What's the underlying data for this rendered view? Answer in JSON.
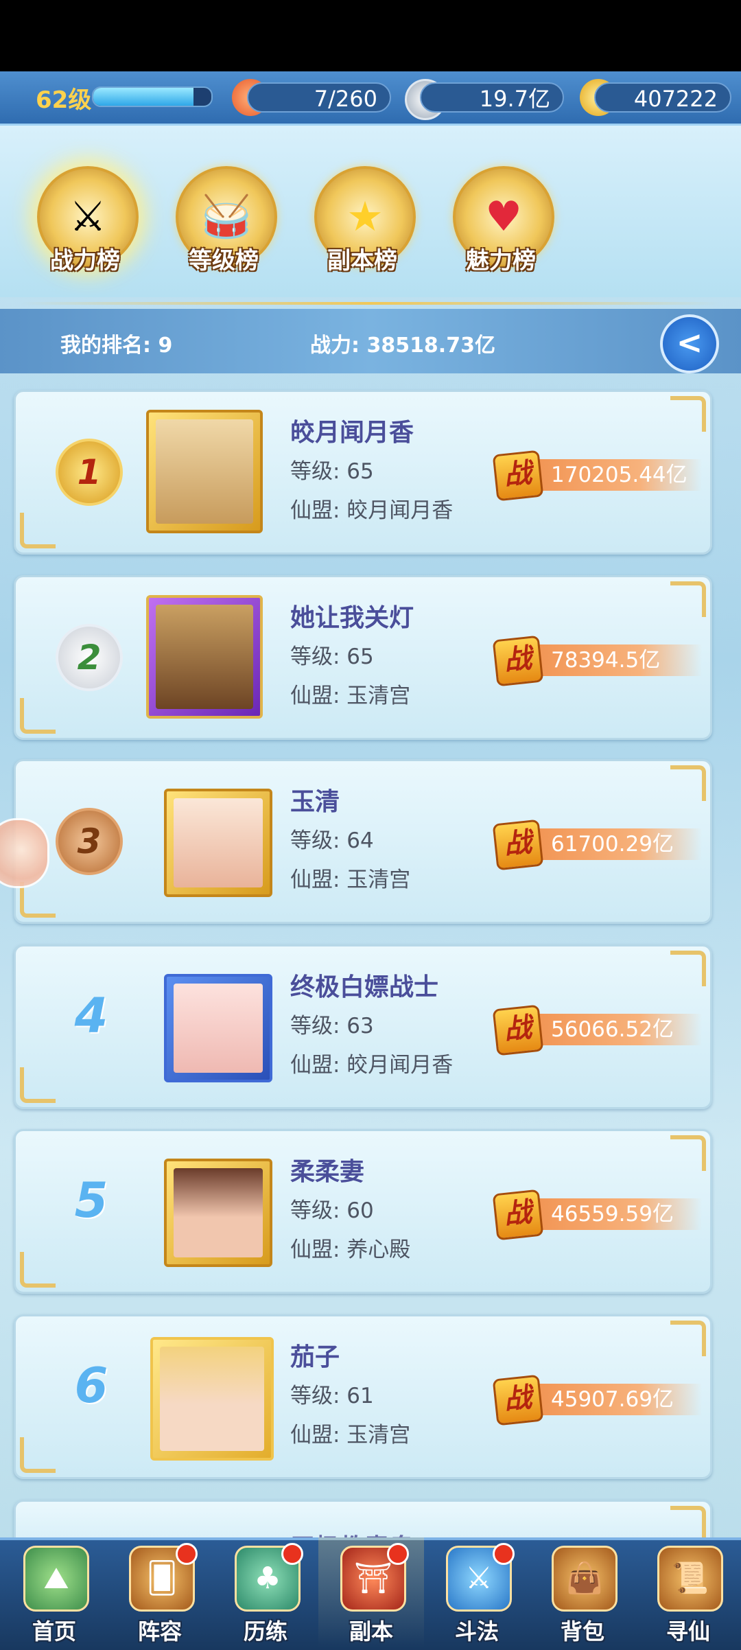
{
  "resources": {
    "level": "62级",
    "xp_fraction": 0.85,
    "stamina": "7/260",
    "silver": "19.7亿",
    "gold": "407222"
  },
  "tabs": [
    {
      "label": "战力榜",
      "icon": "sword-emblem-icon",
      "active": true
    },
    {
      "label": "等级榜",
      "icon": "drum-emblem-icon",
      "active": false
    },
    {
      "label": "副本榜",
      "icon": "star-emblem-icon",
      "active": false
    },
    {
      "label": "魅力榜",
      "icon": "heart-emblem-icon",
      "active": false
    }
  ],
  "my_rank": {
    "rank_text": "我的排名: 9",
    "power_text": "战力: 38518.73亿"
  },
  "power_badge": "战",
  "rankings": [
    {
      "rank": "1",
      "name": "皎月闻月香",
      "level": "等级: 65",
      "alliance": "仙盟: 皎月闻月香",
      "power": "170205.44亿"
    },
    {
      "rank": "2",
      "name": "她让我关灯",
      "level": "等级: 65",
      "alliance": "仙盟: 玉清宫",
      "power": "78394.5亿"
    },
    {
      "rank": "3",
      "name": "玉清",
      "level": "等级: 64",
      "alliance": "仙盟: 玉清宫",
      "power": "61700.29亿"
    },
    {
      "rank": "4",
      "name": "终极白嫖战士",
      "level": "等级: 63",
      "alliance": "仙盟: 皎月闻月香",
      "power": "56066.52亿"
    },
    {
      "rank": "5",
      "name": "柔柔妻",
      "level": "等级: 60",
      "alliance": "仙盟: 养心殿",
      "power": "46559.59亿"
    },
    {
      "rank": "6",
      "name": "茄子",
      "level": "等级: 61",
      "alliance": "仙盟: 玉清宫",
      "power": "45907.69亿"
    }
  ],
  "partial_row_name": "无极教青皇",
  "nav": [
    {
      "label": "首页",
      "icon": "mountain-home-icon",
      "badge": false
    },
    {
      "label": "阵容",
      "icon": "cards-icon",
      "badge": true
    },
    {
      "label": "历练",
      "icon": "gourd-icon",
      "badge": true
    },
    {
      "label": "副本",
      "icon": "temple-gate-icon",
      "badge": true
    },
    {
      "label": "斗法",
      "icon": "crossed-swords-icon",
      "badge": true
    },
    {
      "label": "背包",
      "icon": "bag-icon",
      "badge": false
    },
    {
      "label": "寻仙",
      "icon": "scroll-icon",
      "badge": false
    }
  ]
}
